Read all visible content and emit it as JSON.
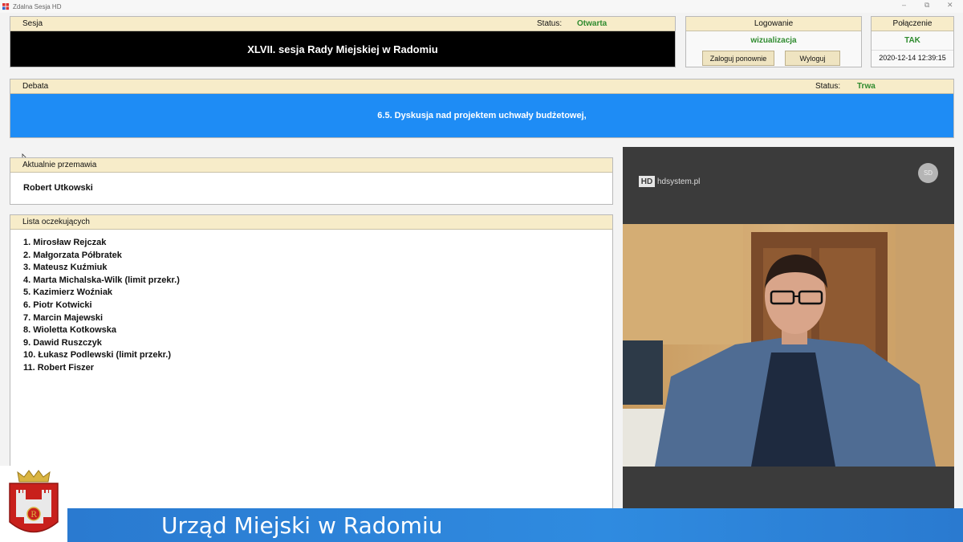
{
  "window": {
    "title": "Zdalna Sesja HD",
    "minimize": "–",
    "maximize": "⧉",
    "close": "✕"
  },
  "sesja": {
    "header_label": "Sesja",
    "status_label": "Status:",
    "status_value": "Otwarta",
    "title": "XLVII. sesja Rady Miejskiej w Radomiu"
  },
  "logowanie": {
    "header_label": "Logowanie",
    "user": "wizualizacja",
    "relogin_label": "Zaloguj ponownie",
    "logout_label": "Wyloguj"
  },
  "polaczenie": {
    "header_label": "Połączenie",
    "value": "TAK",
    "datetime": "2020-12-14 12:39:15"
  },
  "debata": {
    "header_label": "Debata",
    "status_label": "Status:",
    "status_value": "Trwa",
    "topic": "6.5. Dyskusja nad projektem uchwały budżetowej,"
  },
  "przemawia": {
    "header_label": "Aktualnie przemawia",
    "speaker": "Robert Utkowski"
  },
  "oczekujacy": {
    "header_label": "Lista oczekujących",
    "items": [
      "1. Mirosław Rejczak",
      "2. Małgorzata Półbratek",
      "3. Mateusz Kuźmiuk",
      "4. Marta Michalska-Wilk (limit przekr.)",
      "5. Kazimierz Woźniak",
      "6. Piotr Kotwicki",
      "7. Marcin Majewski",
      "8. Wioletta Kotkowska",
      "9. Dawid Ruszczyk",
      "10. Łukasz Podlewski (limit przekr.)",
      "11. Robert Fiszer"
    ]
  },
  "video": {
    "brand_mark": "HD",
    "brand_text": "hdsystem.pl",
    "avatar_initials": "SD"
  },
  "banner": {
    "text": "Urząd Miejski w Radomiu"
  },
  "colors": {
    "header_bg": "#f7ecc9",
    "status_green": "#2e8b2e",
    "debate_blue": "#1e8cf5",
    "banner_blue": "#2f8be0"
  }
}
